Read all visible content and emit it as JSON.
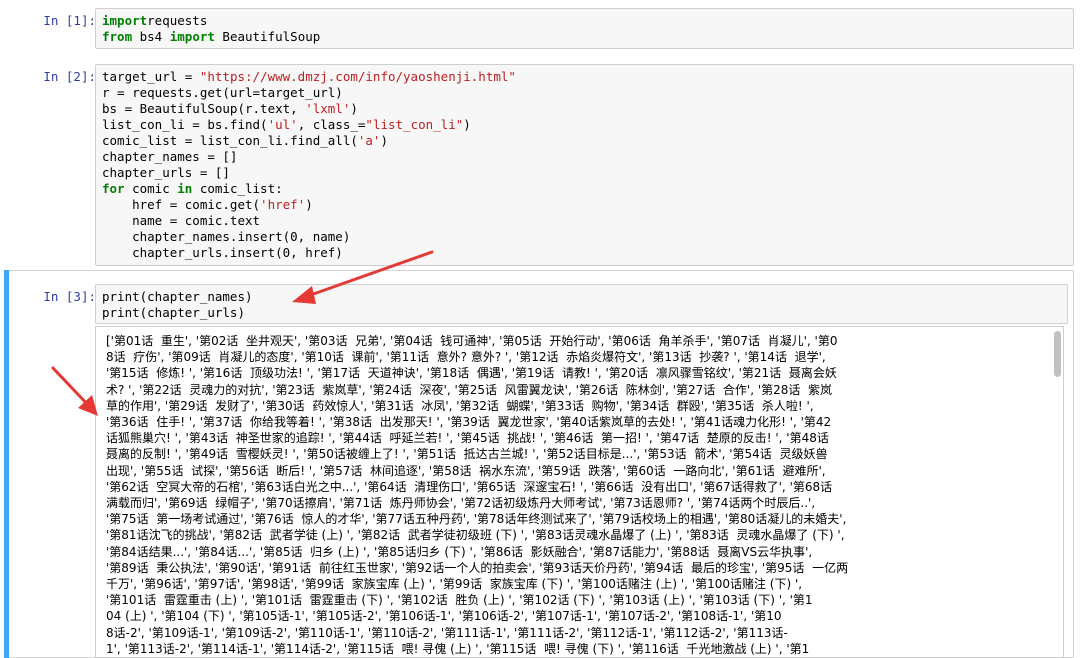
{
  "cells": [
    {
      "prompt": "In [1]:",
      "lines": [
        [
          [
            "kw",
            "import"
          ],
          [
            "",
            "requests"
          ]
        ],
        [
          [
            "kw",
            "from"
          ],
          [
            "",
            " bs4 "
          ],
          [
            "kw",
            "import"
          ],
          [
            "",
            " BeautifulSoup"
          ]
        ]
      ]
    },
    {
      "prompt": "In [2]:",
      "lines": [
        [
          [
            "",
            "target_url = "
          ],
          [
            "str",
            "\"https://www.dmzj.com/info/yaoshenji.html\""
          ]
        ],
        [
          [
            "",
            "r = requests.get(url=target_url)"
          ]
        ],
        [
          [
            "",
            "bs = BeautifulSoup(r.text, "
          ],
          [
            "str",
            "'lxml'"
          ],
          [
            "",
            ")"
          ]
        ],
        [
          [
            "",
            "list_con_li = bs.find("
          ],
          [
            "str",
            "'ul'"
          ],
          [
            "",
            ", class_="
          ],
          [
            "str",
            "\"list_con_li\""
          ],
          [
            "",
            ")"
          ]
        ],
        [
          [
            "",
            "comic_list = list_con_li.find_all("
          ],
          [
            "str",
            "'a'"
          ],
          [
            "",
            ")"
          ]
        ],
        [
          [
            "",
            "chapter_names = []"
          ]
        ],
        [
          [
            "",
            "chapter_urls = []"
          ]
        ],
        [
          [
            "kw",
            "for"
          ],
          [
            "",
            " comic "
          ],
          [
            "kw",
            "in"
          ],
          [
            "",
            " comic_list:"
          ]
        ],
        [
          [
            "",
            "    href = comic.get("
          ],
          [
            "str",
            "'href'"
          ],
          [
            "",
            ")"
          ]
        ],
        [
          [
            "",
            "    name = comic.text"
          ]
        ],
        [
          [
            "",
            "    chapter_names.insert(0, name)"
          ]
        ],
        [
          [
            "",
            "    chapter_urls.insert(0, href)"
          ]
        ]
      ]
    },
    {
      "prompt": "In [3]:",
      "lines": [
        [
          [
            "",
            "print(chapter_names)"
          ]
        ],
        [
          [
            "",
            "print(chapter_urls)"
          ]
        ]
      ]
    }
  ],
  "output_lines": [
    "['第01话  重生', '第02话  坐井观天', '第03话  兄弟', '第04话  钱可通神', '第05话  开始行动', '第06话  角羊杀手', '第07话  肖凝儿', '第0",
    "8话  疗伤', '第09话  肖凝儿的态度', '第10话  课前', '第11话  意外? 意外? ', '第12话  赤焰炎爆符文', '第13话  抄袭? ', '第14话  退学',",
    "'第15话  修炼! ', '第16话  顶级功法! ', '第17话  天道神诀', '第18话  偶遇', '第19话  请教! ', '第20话  凛风骤雪铭纹', '第21话  聂离会妖",
    "术? ', '第22话  灵魂力的对抗', '第23话  紫岚草', '第24话  深夜', '第25话  风雷翼龙诀', '第26话  陈林剑', '第27话  合作', '第28话  紫岚",
    "草的作用', '第29话  发财了', '第30话  药效惊人', '第31话  冰凤', '第32话  蝴蝶', '第33话  购物', '第34话  群殴', '第35话  杀人啦! ',",
    "'第36话  住手! ', '第37话  你给我等着! ', '第38话  出发那天! ', '第39话  翼龙世家', '第40话紫岚草的去处! ', '第41话魂力化形! ', '第42",
    "话狐熊巢穴! ', '第43话  神圣世家的追踪! ', '第44话  呼延兰若! ', '第45话  挑战! ', '第46话  第一招! ', '第47话  楚原的反击! ', '第48话",
    "聂离的反制! ', '第49话  雪樱妖灵! ', '第50话被缠上了! ', '第51话  抵达古兰城! ', '第52话目标是...', '第53话  箭术', '第54话  灵级妖兽",
    "出现', '第55话  试探', '第56话  断后! ', '第57话  林间追逐', '第58话  祸水东流', '第59话  跌落', '第60话  一路向北', '第61话  避难所',",
    "'第62话  空冥大帝的石棺', '第63话白光之中...', '第64话  清理伤口', '第65话  深邃宝石! ', '第66话  没有出口', '第67话得救了', '第68话",
    "满载而归', '第69话  绿帽子', '第70话擦肩', '第71话  炼丹师协会', '第72话初级炼丹大师考试', '第73话恩师? ', '第74话两个时辰后..',",
    "'第75话  第一场考试通过', '第76话  惊人的才华', '第77话五种丹药', '第78话年终测试来了', '第79话校场上的相遇', '第80话凝儿的未婚夫',",
    "'第81话沈飞的挑战', '第82话  武者学徒 (上) ', '第82话  武者学徒初级班 (下) ', '第83话灵魂水晶爆了 (上) ', '第83话  灵魂水晶爆了 (下) ',",
    "'第84话结果...', '第84话...', '第85话  归乡 (上) ', '第85话归乡 (下) ', '第86话  影妖融合', '第87话能力', '第88话  聂离VS云华执事',",
    "'第89话  秉公执法', '第90话', '第91话  前往红玉世家', '第92话一个人的拍卖会', '第93话天价丹药', '第94话  最后的珍宝', '第95话  一亿两",
    "千万', '第96话', '第97话', '第98话', '第99话  家族宝库 (上) ', '第99话  家族宝库 (下) ', '第100话赌注 (上) ', '第100话赌注 (下) ',",
    "'第101话  雷霆重击 (上) ', '第101话  雷霆重击 (下) ', '第102话  胜负 (上) ', '第102话 (下) ', '第103话 (上) ', '第103话 (下) ', '第1",
    "04 (上) ', '第104 (下) ', '第105话-1', '第105话-2', '第106话-1', '第106话-2', '第107话-1', '第107话-2', '第108话-1', '第10",
    "8话-2', '第109话-1', '第109话-2', '第110话-1', '第110话-2', '第111话-1', '第111话-2', '第112话-1', '第112话-2', '第113话-",
    "1', '第113话-2', '第114话-1', '第114话-2', '第115话  喂! 寻傀 (上) ', '第115话  喂! 寻傀 (下) ', '第116话  千光地激战 (上) ', '第1"
  ],
  "colors": {
    "prompt": "#303f9f",
    "keyword": "#008000",
    "string": "#ba2121",
    "arrow": "#e53935",
    "selected_bar": "#42a5f5"
  },
  "icons": [
    "red-arrow-to-code",
    "red-arrow-to-output"
  ]
}
